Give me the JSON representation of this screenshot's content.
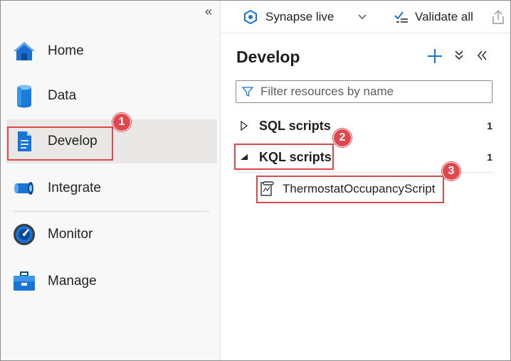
{
  "nav": {
    "collapse_icon": "double-chevron-left-icon",
    "items": [
      {
        "label": "Home",
        "icon": "home-icon"
      },
      {
        "label": "Data",
        "icon": "database-icon"
      },
      {
        "label": "Develop",
        "icon": "document-icon",
        "selected": true
      },
      {
        "label": "Integrate",
        "icon": "pipeline-icon"
      },
      {
        "label": "Monitor",
        "icon": "gauge-icon"
      },
      {
        "label": "Manage",
        "icon": "toolbox-icon"
      }
    ]
  },
  "toolbar": {
    "live_label": "Synapse live",
    "live_icon": "synapse-icon",
    "chevron_icon": "chevron-down-icon",
    "validate_label": "Validate all",
    "validate_icon": "checklist-icon",
    "publish_icon": "publish-icon"
  },
  "panel": {
    "title": "Develop",
    "add_icon": "plus-icon",
    "expand_icon": "expand-all-icon",
    "collapse_icon": "collapse-panel-icon",
    "filter_placeholder": "Filter resources by name",
    "filter_value": "",
    "groups": [
      {
        "label": "SQL scripts",
        "count": "1",
        "expanded": false
      },
      {
        "label": "KQL scripts",
        "count": "1",
        "expanded": true
      }
    ],
    "kql_items": [
      {
        "label": "ThermostatOccupancyScript",
        "icon": "kql-script-icon"
      }
    ]
  },
  "callouts": [
    "1",
    "2",
    "3"
  ],
  "colors": {
    "accent": "#0078d4",
    "callout": "#e0474c",
    "nav_bg": "#f8f8f8",
    "nav_selected": "#e9e8e6"
  }
}
